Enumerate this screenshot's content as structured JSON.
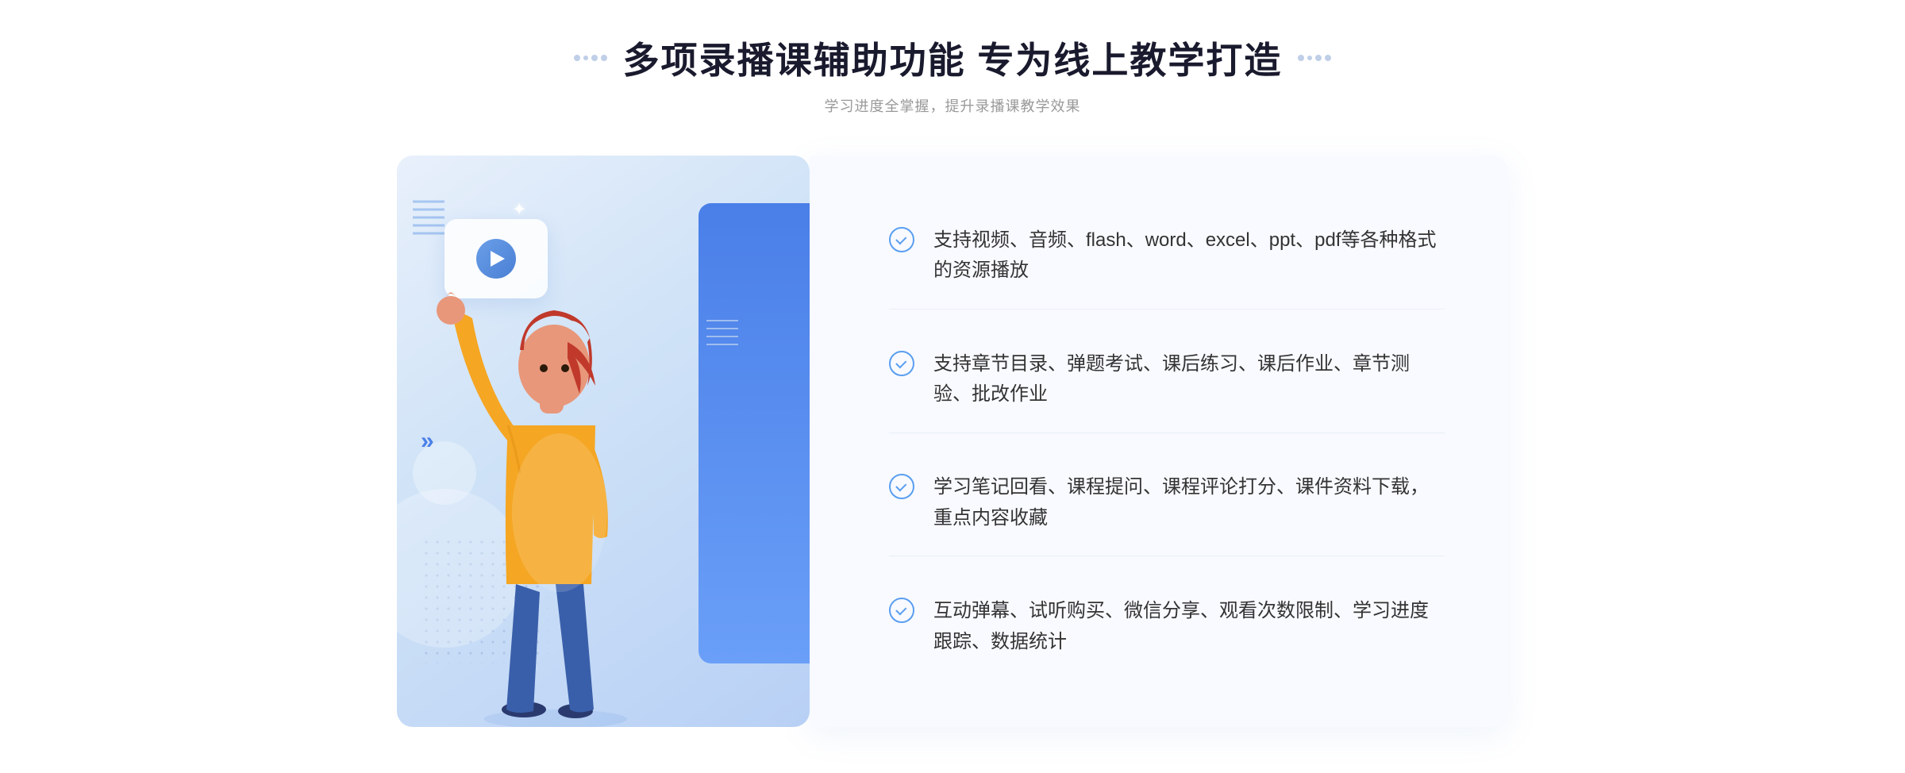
{
  "header": {
    "title": "多项录播课辅助功能 专为线上教学打造",
    "subtitle": "学习进度全掌握，提升录播课教学效果",
    "left_dots_decoration": "···",
    "right_dots_decoration": "···"
  },
  "features": [
    {
      "id": 1,
      "text": "支持视频、音频、flash、word、excel、ppt、pdf等各种格式的资源播放"
    },
    {
      "id": 2,
      "text": "支持章节目录、弹题考试、课后练习、课后作业、章节测验、批改作业"
    },
    {
      "id": 3,
      "text": "学习笔记回看、课程提问、课程评论打分、课件资料下载，重点内容收藏"
    },
    {
      "id": 4,
      "text": "互动弹幕、试听购买、微信分享、观看次数限制、学习进度跟踪、数据统计"
    }
  ],
  "left_panel": {
    "video_label": "▶",
    "arrow_left": "»"
  }
}
